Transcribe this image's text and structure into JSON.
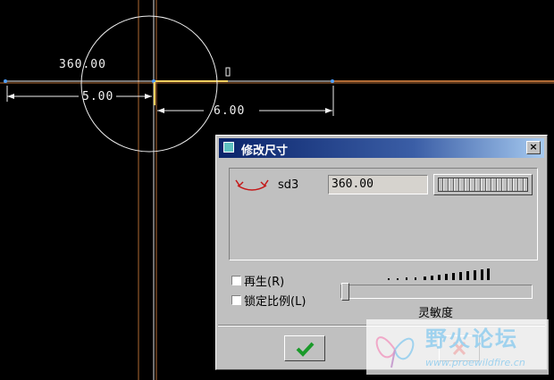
{
  "sketch": {
    "dim_angle": "360.00",
    "dim_left": "5.00",
    "dim_right": "6.00"
  },
  "dialog": {
    "title": "修改尺寸",
    "close_label": "×",
    "dimension": {
      "icon": "angle-dimension-icon",
      "name": "sd3",
      "value": "360.00"
    },
    "regenerate_label": "再生(R)",
    "regenerate_checked": false,
    "lock_scale_label": "锁定比例(L)",
    "lock_scale_checked": false,
    "sensitivity_label": "灵敏度",
    "sensitivity_level": 0,
    "ok_icon": "checkmark-icon",
    "cancel_icon": "cross-icon"
  },
  "watermark": {
    "title": "野火论坛",
    "url": "www.proewildfire.cn"
  },
  "colors": {
    "background": "#000000",
    "sketch_white": "#f2f2f2",
    "reference_line": "#c0703a",
    "dialog_face": "#c0c0c0",
    "title_gradient_start": "#0a246a",
    "ok_green": "#1a9a2a",
    "cancel_red": "#c41818"
  }
}
